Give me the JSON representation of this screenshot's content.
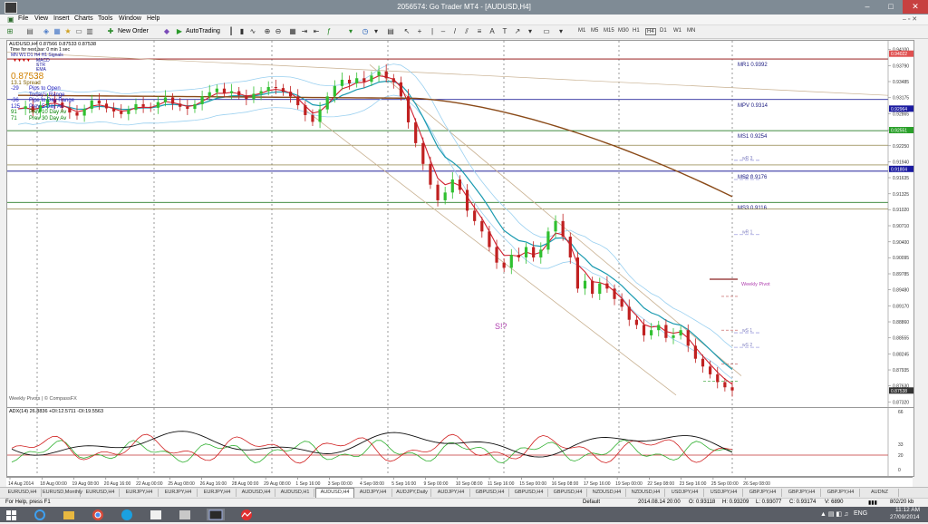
{
  "window": {
    "title": "2056574: Go Trader MT4 - [AUDUSD,H4]",
    "min": "–",
    "max": "□",
    "close": "✕"
  },
  "menu": [
    "File",
    "View",
    "Insert",
    "Charts",
    "Tools",
    "Window",
    "Help"
  ],
  "toolbar": {
    "new_order": "New Order",
    "autotrading": "AutoTrading",
    "timeframes": [
      "M1",
      "M5",
      "M15",
      "M30",
      "H1",
      "H4",
      "D1",
      "W1",
      "MN"
    ]
  },
  "chart": {
    "header": "AUDUSD,H4  0.87566 0.87533 0.87538",
    "indicator_lines": [
      "Time for next bar: 0 min 1 sec",
      "MN  W1  D1  H4  H1  Signals",
      "MACD",
      "STR",
      "EMA"
    ],
    "price_big": "0.87538",
    "spread_line": "13.1  Spread",
    "info_lines": [
      "Pips to Open",
      "Today's Range",
      "Pips to Day Range",
      "Prev 5 Day Av",
      "Prev 10 Day Av",
      "Prev 30 Day Av"
    ],
    "info_values": [
      "-29",
      "",
      "-36",
      "125",
      "91",
      "71"
    ],
    "info_colors": [
      "#2020c0",
      "#2020c0",
      "#2020c0",
      "#2020c0",
      "#008000",
      "#008000"
    ],
    "watermark": "Weekly Pivots | © CompassFX",
    "annotation": "S!?",
    "weekly_pivot_label": "Weekly Pivot",
    "pivot_labels": [
      {
        "text": "MR1",
        "value": "0.9392"
      },
      {
        "text": "MPV",
        "value": "0.9314"
      },
      {
        "text": "MS1",
        "value": "0.9254"
      },
      {
        "text": "MS2",
        "value": "0.9176"
      },
      {
        "text": "MS3",
        "value": "0.9116"
      }
    ],
    "weekly_labels": [
      "wR 3",
      "wR 2",
      "wR 1",
      "wS 1",
      "wS 2"
    ],
    "indicator_header": "ADX(14) 26.8836  +DI:12.5711  -DI:19.5563",
    "indicator_scale": [
      "66",
      "33",
      "20",
      "0"
    ]
  },
  "chart_data": {
    "type": "line",
    "title": "AUDUSD,H4",
    "y_axis_ticks": [
      "0.94100",
      "0.93790",
      "0.93485",
      "0.93175",
      "0.92865",
      "0.92555",
      "0.92250",
      "0.91940",
      "0.91635",
      "0.91325",
      "0.91020",
      "0.90710",
      "0.90400",
      "0.90095",
      "0.89785",
      "0.89480",
      "0.89170",
      "0.88860",
      "0.88555",
      "0.88245",
      "0.87935",
      "0.87630",
      "0.87320"
    ],
    "ylim": [
      0.8722,
      0.9427
    ],
    "x_labels": [
      "14 Aug 2014",
      "18 Aug 00:00",
      "19 Aug 08:00",
      "20 Aug 16:00",
      "22 Aug 00:00",
      "25 Aug 08:00",
      "26 Aug 16:00",
      "28 Aug 00:00",
      "29 Aug 08:00",
      "1 Sep 16:00",
      "3 Sep 00:00",
      "4 Sep 08:00",
      "5 Sep 16:00",
      "9 Sep 00:00",
      "10 Sep 08:00",
      "11 Sep 16:00",
      "15 Sep 00:00",
      "16 Sep 08:00",
      "17 Sep 16:00",
      "19 Sep 00:00",
      "22 Sep 08:00",
      "23 Sep 16:00",
      "25 Sep 00:00",
      "26 Sep 08:00"
    ],
    "price_tags": [
      {
        "value": 0.94022,
        "text": "0.94022",
        "color": "#e05050"
      },
      {
        "value": 0.92964,
        "text": "0.92964",
        "color": "#1a1aa0"
      },
      {
        "value": 0.92551,
        "text": "0.92551",
        "color": "#2aa02a"
      },
      {
        "value": 0.91804,
        "text": "0.91804",
        "color": "#1a1aa0"
      },
      {
        "value": 0.87538,
        "text": "0.87538",
        "color": "#333333"
      }
    ],
    "series": [
      {
        "name": "Close",
        "values": [
          0.9296,
          0.9301,
          0.929,
          0.9303,
          0.9315,
          0.9308,
          0.9298,
          0.9289,
          0.9283,
          0.9296,
          0.9312,
          0.9306,
          0.9297,
          0.9291,
          0.9286,
          0.9294,
          0.9305,
          0.93,
          0.9298,
          0.9309,
          0.9318,
          0.9306,
          0.93,
          0.9296,
          0.9305,
          0.932,
          0.9328,
          0.9335,
          0.9326,
          0.933,
          0.9322,
          0.9315,
          0.9325,
          0.933,
          0.9338,
          0.9336,
          0.9329,
          0.932,
          0.9303,
          0.9284,
          0.9271,
          0.9295,
          0.932,
          0.934,
          0.9352,
          0.9345,
          0.9355,
          0.9348,
          0.936,
          0.9368,
          0.9355,
          0.9347,
          0.932,
          0.927,
          0.923,
          0.919,
          0.915,
          0.912,
          0.9135,
          0.916,
          0.914,
          0.91,
          0.908,
          0.906,
          0.903,
          0.9,
          0.899,
          0.9015,
          0.901,
          0.903,
          0.901,
          0.9025,
          0.906,
          0.908,
          0.905,
          0.901,
          0.895,
          0.8965,
          0.894,
          0.896,
          0.895,
          0.893,
          0.8915,
          0.889,
          0.888,
          0.886,
          0.887,
          0.888,
          0.8855,
          0.886,
          0.887,
          0.884,
          0.8815,
          0.88,
          0.8785,
          0.877,
          0.876,
          0.8754
        ]
      }
    ],
    "ind_series": [
      "ADX",
      "+DI",
      "-DI"
    ]
  },
  "tabs": [
    "EURUSD,H4",
    "EURUSD,Monthly",
    "EURUSD,H4",
    "EURJPY,H4",
    "EURJPY,H4",
    "EURJPY,H4",
    "AUDUSD,H4",
    "AUDUSD,H1",
    "AUDUSD,H4",
    "AUDJPY,H4",
    "AUDJPY,Daily",
    "AUDJPY,H4",
    "GBPUSD,H4",
    "GBPUSD,H4",
    "GBPUSD,H4",
    "NZDUSD,H4",
    "NZDUSD,H4",
    "USDJPY,H4",
    "USDJPY,H4",
    "GBPJPY,H4",
    "GBPJPY,H4",
    "GBPJPY,H4",
    "AUDNZ"
  ],
  "status": {
    "help": "For Help, press F1",
    "profile": "Default",
    "datetime": "2014.08.14 20:00",
    "o": "O: 0.93118",
    "h": "H: 0.93209",
    "l": "L: 0.93077",
    "c": "C: 0.93174",
    "v": "V: 6890",
    "kb": "802/20 kb"
  },
  "taskbar": {
    "lang": "ENG",
    "time": "11:12 AM",
    "date": "27/09/2014"
  }
}
